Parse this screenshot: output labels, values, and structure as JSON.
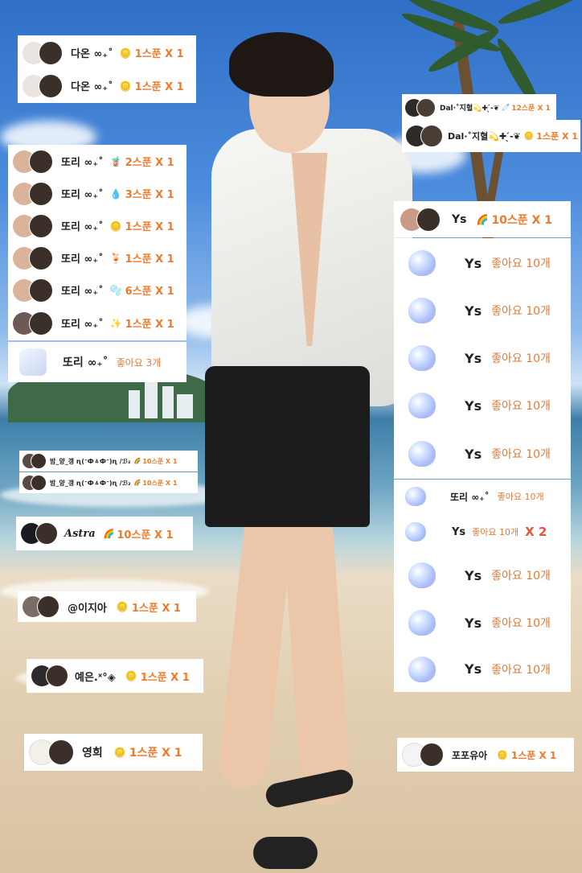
{
  "chips": {
    "daon1": {
      "name": "다온 ∞₊˚",
      "gift": "1스푼 X 1",
      "icon": "coin-icon"
    },
    "daon2": {
      "name": "다온 ∞₊˚",
      "gift": "1스푼 X 1",
      "icon": "coin-icon"
    },
    "dal1": {
      "name": "Dal·˚지혈💫✚ ̖́-❦",
      "gift": "12스푼 X 1",
      "icon": "pin-icon"
    },
    "dal2": {
      "name": "Dal·˚지혈💫✚ ̖́-❦",
      "gift": "1스푼 X 1",
      "icon": "coin-icon"
    },
    "ddori1": {
      "name": "또리 ∞₊˚",
      "gift": "2스푼 X 1",
      "icon": "coffee-icon"
    },
    "ddori2": {
      "name": "또리 ∞₊˚",
      "gift": "3스푼 X 1",
      "icon": "droplet-icon"
    },
    "ddori3": {
      "name": "또리 ∞₊˚",
      "gift": "1스푼 X 1",
      "icon": "coin-icon"
    },
    "ddori4": {
      "name": "또리 ∞₊˚",
      "gift": "1스푼 X 1",
      "icon": "drink-icon"
    },
    "ddori5": {
      "name": "또리 ∞₊˚",
      "gift": "6스푼 X 1",
      "icon": "bubbles-icon"
    },
    "ddori6": {
      "name": "또리 ∞₊˚",
      "gift": "1스푼 X 1",
      "icon": "sparkle-icon"
    },
    "ddori_like": {
      "name": "또리 ∞₊˚",
      "like": "좋아요 3개",
      "icon": "dice-icon"
    },
    "ys_top": {
      "name": "Ys",
      "gift": "10스푼 X 1",
      "icon": "rainbow-icon"
    },
    "bam1": {
      "name": "밤_양_갱 ɳ(ᵔФㅿФᵔ)ɳ /ℬ₂",
      "gift": "10스푼 X 1",
      "icon": "rainbow-icon"
    },
    "bam2": {
      "name": "밤_양_갱 ɳ(ᵔФㅿФᵔ)ɳ /ℬ₂",
      "gift": "10스푼 X 1",
      "icon": "rainbow-icon"
    },
    "astra": {
      "name": "Astra",
      "gift": "10스푼 X 1",
      "icon": "rainbow-icon"
    },
    "jia": {
      "name": "@이지아",
      "gift": "1스푼 X 1",
      "icon": "coin-icon"
    },
    "yeeun": {
      "name": "예은.ˣ°◈",
      "gift": "1스푼 X 1",
      "icon": "coin-icon"
    },
    "younghee": {
      "name": "영희",
      "gift": "1스푼 X 1",
      "icon": "coin-icon"
    },
    "popo": {
      "name": "포포유아",
      "gift": "1스푼 X 1",
      "icon": "coin-icon"
    }
  },
  "likes": [
    {
      "name": "Ys",
      "like": "좋아요 10개",
      "x2": ""
    },
    {
      "name": "Ys",
      "like": "좋아요 10개",
      "x2": ""
    },
    {
      "name": "Ys",
      "like": "좋아요 10개",
      "x2": ""
    },
    {
      "name": "Ys",
      "like": "좋아요 10개",
      "x2": ""
    },
    {
      "name": "Ys",
      "like": "좋아요 10개",
      "x2": ""
    },
    {
      "name": "또리 ∞₊˚",
      "like": "좋아요 10개",
      "x2": ""
    },
    {
      "name": "Ys",
      "like": "좋아요 10개",
      "x2": "X 2"
    },
    {
      "name": "Ys",
      "like": "좋아요 10개",
      "x2": ""
    },
    {
      "name": "Ys",
      "like": "좋아요 10개",
      "x2": ""
    },
    {
      "name": "Ys",
      "like": "좋아요 10개",
      "x2": ""
    }
  ],
  "icons": {
    "coin-icon": "🪙",
    "pin-icon": "🧷",
    "coffee-icon": "🧋",
    "droplet-icon": "💧",
    "drink-icon": "🍹",
    "bubbles-icon": "🫧",
    "sparkle-icon": "✨",
    "rainbow-icon": "🌈"
  },
  "colors": {
    "gift": "#f07a2b",
    "like": "#e07b3c",
    "x2": "#e8543a"
  }
}
